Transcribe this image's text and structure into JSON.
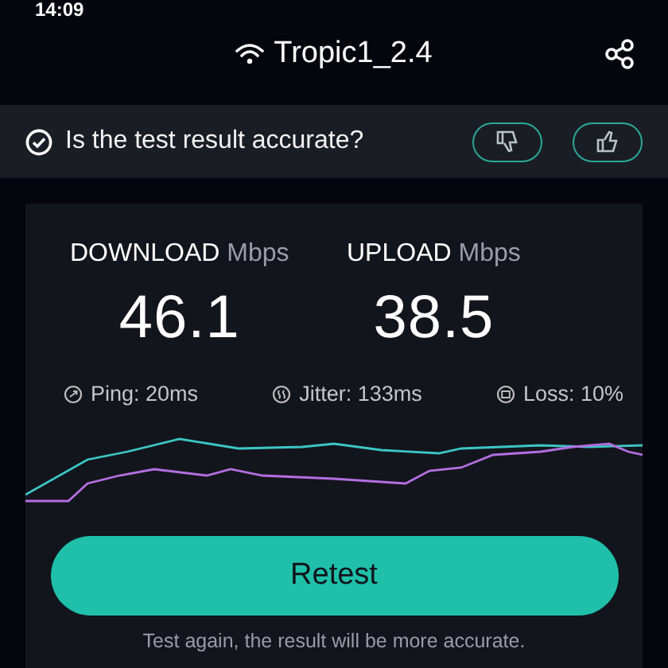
{
  "status_bar": {
    "time": "14:09"
  },
  "header": {
    "title": "Tropic1_2.4"
  },
  "feedback": {
    "question": "Is the test result accurate?"
  },
  "results": [
    {
      "label": "DOWNLOAD",
      "unit": "Mbps",
      "value": "46.1"
    },
    {
      "label": "UPLOAD",
      "unit": "Mbps",
      "value": "38.5"
    }
  ],
  "metrics": [
    {
      "kind": "ping",
      "text": "Ping: 20ms"
    },
    {
      "kind": "jitter",
      "text": "Jitter: 133ms"
    },
    {
      "kind": "loss",
      "text": "Loss: 10%"
    }
  ],
  "retest_button": "Retest",
  "hint": "Test again, the result will be more accurate."
}
